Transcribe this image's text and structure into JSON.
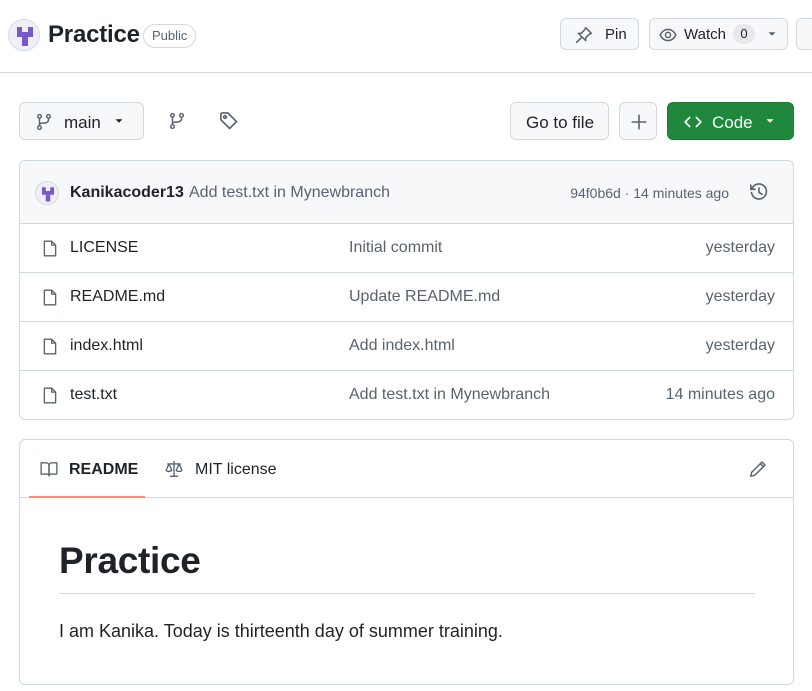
{
  "header": {
    "repo_name": "Practice",
    "visibility": "Public",
    "pin_label": "Pin",
    "watch_label": "Watch",
    "watch_count": "0"
  },
  "toolbar": {
    "branch": "main",
    "goto_label": "Go to file",
    "code_label": "Code"
  },
  "latest_commit": {
    "author": "Kanikacoder13",
    "message": "Add test.txt in Mynewbranch",
    "meta": "94f0b6d · 14 minutes ago"
  },
  "files": [
    {
      "name": "LICENSE",
      "commit": "Initial commit",
      "age": "yesterday"
    },
    {
      "name": "README.md",
      "commit": "Update README.md",
      "age": "yesterday"
    },
    {
      "name": "index.html",
      "commit": "Add index.html",
      "age": "yesterday"
    },
    {
      "name": "test.txt",
      "commit": "Add test.txt in Mynewbranch",
      "age": "14 minutes ago"
    }
  ],
  "readme": {
    "tab_readme": "README",
    "tab_license": "MIT license",
    "title": "Practice",
    "body": "I am Kanika. Today is thirteenth day of summer training."
  },
  "icons": {
    "pin": "pin-icon",
    "watch": "eye-icon",
    "branch": "git-branch-icon",
    "tags": "tag-icon",
    "add": "plus-icon",
    "code": "code-icon",
    "history": "history-icon",
    "file": "file-icon",
    "book": "book-icon",
    "law": "law-icon",
    "edit": "pencil-icon"
  },
  "colors": {
    "primary_green": "#1f883d",
    "tab_underline": "#fd8c73",
    "avatar_purple": "#7759c8",
    "muted_text": "#59636e",
    "border": "#d1d9e0"
  }
}
